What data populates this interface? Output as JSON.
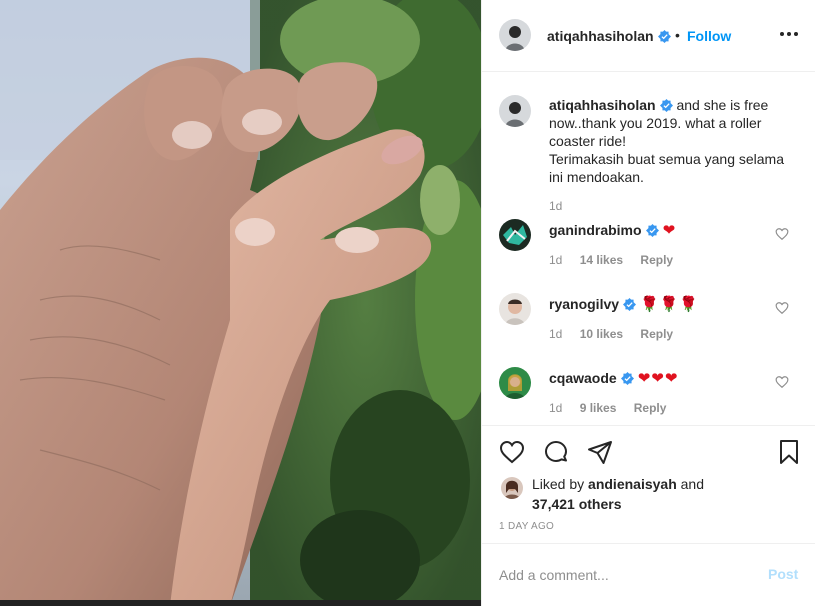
{
  "post": {
    "author": "atiqahhasiholan",
    "dot": "•",
    "follow_label": "Follow",
    "more_icon": "more-options-icon"
  },
  "caption": {
    "username": "atiqahhasiholan",
    "line1": "and she is free now..thank you 2019. what a roller coaster ride!",
    "line2": "Terimakasih buat semua yang selama ini mendoakan.",
    "time": "1d"
  },
  "comments": [
    {
      "username": "ganindrabimo",
      "emoji": "❤",
      "time": "1d",
      "likes": "14 likes",
      "reply": "Reply"
    },
    {
      "username": "ryanogilvy",
      "emoji": "🌹🌹🌹",
      "time": "1d",
      "likes": "10 likes",
      "reply": "Reply"
    },
    {
      "username": "cqawaode",
      "emoji": "❤❤❤",
      "time": "1d",
      "likes": "9 likes",
      "reply": "Reply"
    }
  ],
  "likes": {
    "prefix": "Liked by",
    "user": "andienaisyah",
    "connector": "and",
    "count": "37,421 others"
  },
  "date": "1 DAY AGO",
  "add_comment": {
    "placeholder": "Add a comment...",
    "post_label": "Post"
  },
  "colors": {
    "accent": "#0095f6",
    "post_disabled": "#b2dffc",
    "verified": "#3897f0",
    "heart_red": "#e0121f"
  }
}
